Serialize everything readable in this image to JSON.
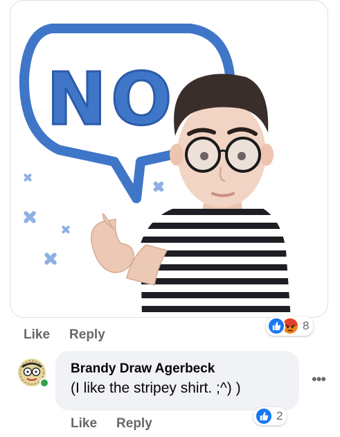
{
  "sticker": {
    "speech_text": "NO",
    "icon": "memoji-sticker-no"
  },
  "first_comment": {
    "actions": {
      "like": "Like",
      "reply": "Reply"
    },
    "reactions": {
      "icons": [
        "like-icon",
        "angry-icon"
      ],
      "count": "8"
    }
  },
  "second_comment": {
    "author": "Brandy Draw Agerbeck",
    "text": "(I like the stripey shirt. ;^) )",
    "actions": {
      "like": "Like",
      "reply": "Reply"
    },
    "reactions": {
      "icons": [
        "like-icon"
      ],
      "count": "2"
    },
    "more_icon": "more-horizontal-icon",
    "more_label": "•••"
  },
  "colors": {
    "facebook_blue": "#1877f2",
    "bubble_bg": "#f0f2f5",
    "secondary_text": "#65676b",
    "sticker_blue": "#3f76c8",
    "online_green": "#31a24c"
  }
}
